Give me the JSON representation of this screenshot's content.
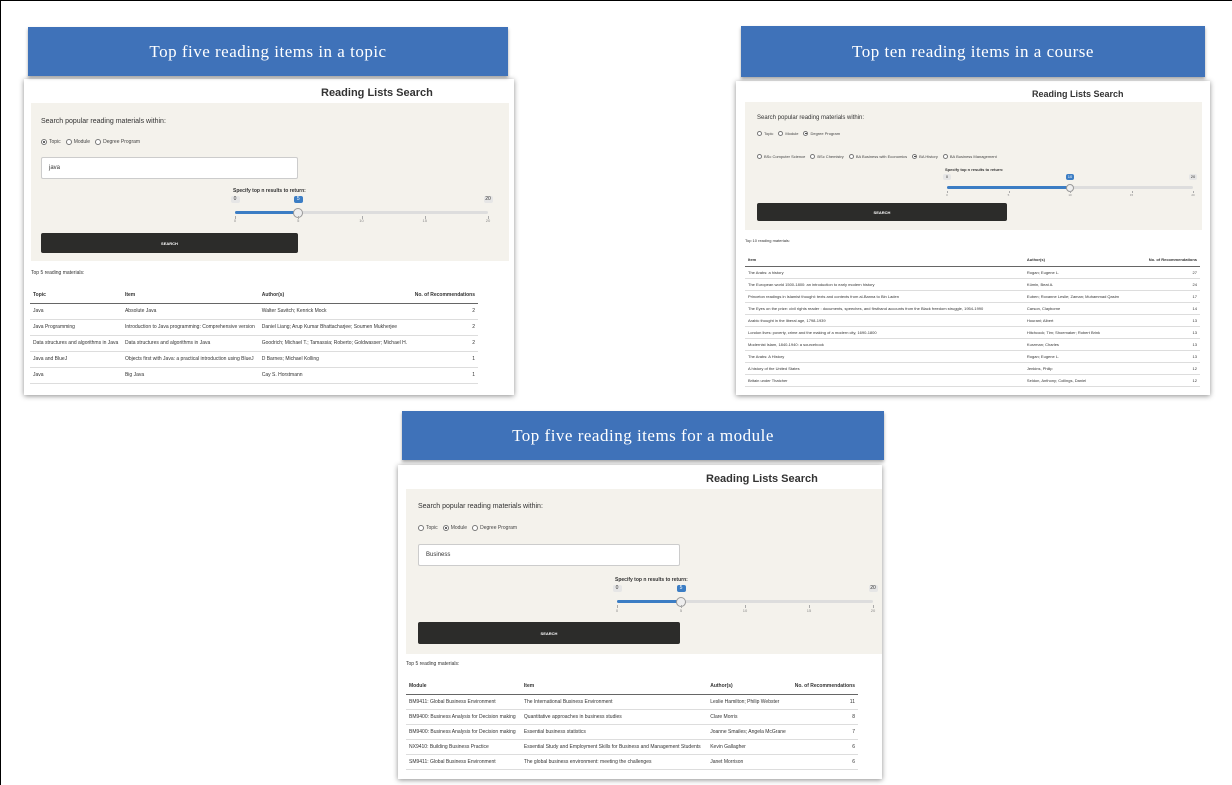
{
  "panels": {
    "topic": {
      "banner": "Top five reading items in a topic",
      "page_title": "Reading Lists Search",
      "prompt": "Search popular reading materials within:",
      "scope_options": [
        {
          "label": "Topic",
          "checked": true
        },
        {
          "label": "Module",
          "checked": false
        },
        {
          "label": "Degree Program",
          "checked": false
        }
      ],
      "search_value": "java",
      "slider": {
        "label": "Specify top n results to return:",
        "min": "0",
        "max": "20",
        "value": "5",
        "ticks": [
          "0",
          "5",
          "10",
          "15",
          "20"
        ]
      },
      "button": "SEARCH",
      "result_count": "Top 5 reading materials:",
      "columns": [
        "Topic",
        "Item",
        "Author(s)",
        "No. of Recommendations"
      ],
      "rows": [
        [
          "Java",
          "Absolute Java",
          "Walter Savitch; Kenrick Mock",
          "2"
        ],
        [
          "Java Programming",
          "Introduction to Java programming: Comprehensive version",
          "Daniel Liang; Arup Kumar Bhattacharjee; Soumen Mukherjee",
          "2"
        ],
        [
          "Data structures and algorithms in Java",
          "Data structures and algorithms in Java",
          "Goodrich; Michael T.; Tamassia; Roberto; Goldwasser; Michael H.",
          "2"
        ],
        [
          "Java and BlueJ",
          "Objects first with Java: a practical introduction using BlueJ",
          "D Barnes; Michael Kolling",
          "1"
        ],
        [
          "Java",
          "Big Java",
          "Cay S. Horstmann",
          "1"
        ]
      ]
    },
    "course": {
      "banner": "Top ten reading items in a course",
      "page_title": "Reading Lists Search",
      "prompt": "Search popular reading materials within:",
      "scope_options": [
        {
          "label": "Topic",
          "checked": false
        },
        {
          "label": "Module",
          "checked": false
        },
        {
          "label": "Degree Program",
          "checked": true
        }
      ],
      "program_options": [
        {
          "label": "BSc Computer Science",
          "checked": false
        },
        {
          "label": "BSc Chemistry",
          "checked": false
        },
        {
          "label": "BA Business with Economics",
          "checked": false
        },
        {
          "label": "BA History",
          "checked": true
        },
        {
          "label": "BA Business Management",
          "checked": false
        }
      ],
      "slider": {
        "label": "Specify top n results to return:",
        "min": "0",
        "max": "20",
        "value": "10",
        "ticks": [
          "0",
          "5",
          "10",
          "15",
          "20"
        ]
      },
      "button": "SEARCH",
      "result_count": "Top 10 reading materials:",
      "columns": [
        "Item",
        "Author(s)",
        "No. of Recommendations"
      ],
      "rows": [
        [
          "The Arabs: a history",
          "Rogan; Eugene L.",
          "27"
        ],
        [
          "The European world 1500-1800: an introduction to early modern history",
          "Kümin, Beat A.",
          "24"
        ],
        [
          "Princeton readings in Islamist thought: texts and contexts from al-Banna to Bin Laden",
          "Euben; Roxanne Leslie; Zaman; Muhammad Qasim",
          "17"
        ],
        [
          "The Eyes on the prize: civil rights reader : documents, speeches, and firsthand accounts from the Black freedom struggle, 1954-1990",
          "Carson, Clayborne",
          "14"
        ],
        [
          "Arabic thought in the liberal age, 1798-1939",
          "Hourani; Albert",
          "13"
        ],
        [
          "London lives: poverty, crime and the making of a modern city, 1690-1800",
          "Hitchcock; Tim; Shoemaker; Robert Brink",
          "13"
        ],
        [
          "Modernist Islam, 1840-1940: a sourcebook",
          "Kurzman; Charles",
          "13"
        ],
        [
          "The Arabs: A History",
          "Rogan; Eugene L.",
          "13"
        ],
        [
          "A history of the United States",
          "Jenkins, Philip",
          "12"
        ],
        [
          "Britain under Thatcher",
          "Seldon, Anthony; Collings, Daniel",
          "12"
        ]
      ]
    },
    "module": {
      "banner": "Top five reading items for a module",
      "page_title": "Reading Lists Search",
      "prompt": "Search popular reading materials within:",
      "scope_options": [
        {
          "label": "Topic",
          "checked": false
        },
        {
          "label": "Module",
          "checked": true
        },
        {
          "label": "Degree Program",
          "checked": false
        }
      ],
      "search_value": "Business",
      "slider": {
        "label": "Specify top n results to return:",
        "min": "0",
        "max": "20",
        "value": "5",
        "ticks": [
          "0",
          "5",
          "10",
          "15",
          "20"
        ]
      },
      "button": "SEARCH",
      "result_count": "Top 5 reading materials:",
      "columns": [
        "Module",
        "Item",
        "Author(s)",
        "No. of Recommendations"
      ],
      "rows": [
        [
          "BM9411: Global Business Environment",
          "The International Business Environment",
          "Leslie Hamilton; Philip Webster",
          "11"
        ],
        [
          "BM9400: Business Analysis for Decision making",
          "Quantitative approaches in business studies",
          "Clare Morris",
          "8"
        ],
        [
          "BM9400: Business Analysis for Decision making",
          "Essential business statistics",
          "Joanne Smailes; Angela McGrane",
          "7"
        ],
        [
          "NX9410: Building Business Practice",
          "Essential Study and Employment Skills for Business and Management Students",
          "Kevin Gallagher",
          "6"
        ],
        [
          "SM9411: Global Business Environment",
          "The global business environment: meeting the challenges",
          "Janet Morrison",
          "6"
        ]
      ]
    }
  }
}
